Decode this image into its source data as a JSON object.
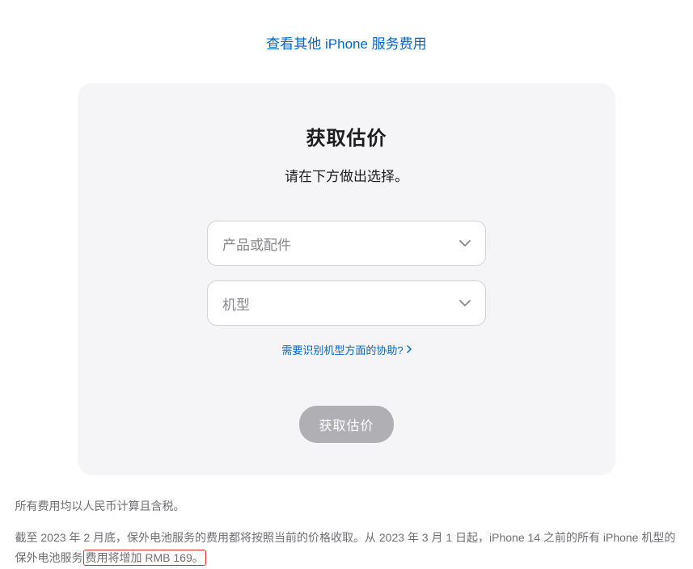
{
  "topLink": "查看其他 iPhone 服务费用",
  "card": {
    "title": "获取估价",
    "subtitle": "请在下方做出选择。",
    "select1Placeholder": "产品或配件",
    "select2Placeholder": "机型",
    "helpLink": "需要识别机型方面的协助?",
    "submitLabel": "获取估价"
  },
  "footer": {
    "line1": "所有费用均以人民币计算且含税。",
    "line2a": "截至 2023 年 2 月底，保外电池服务的费用都将按照当前的价格收取。从 2023 年 3 月 1 日起，iPhone 14 之前的所有 iPhone 机型的保外电池服务",
    "line2b": "费用将增加 RMB 169。"
  }
}
